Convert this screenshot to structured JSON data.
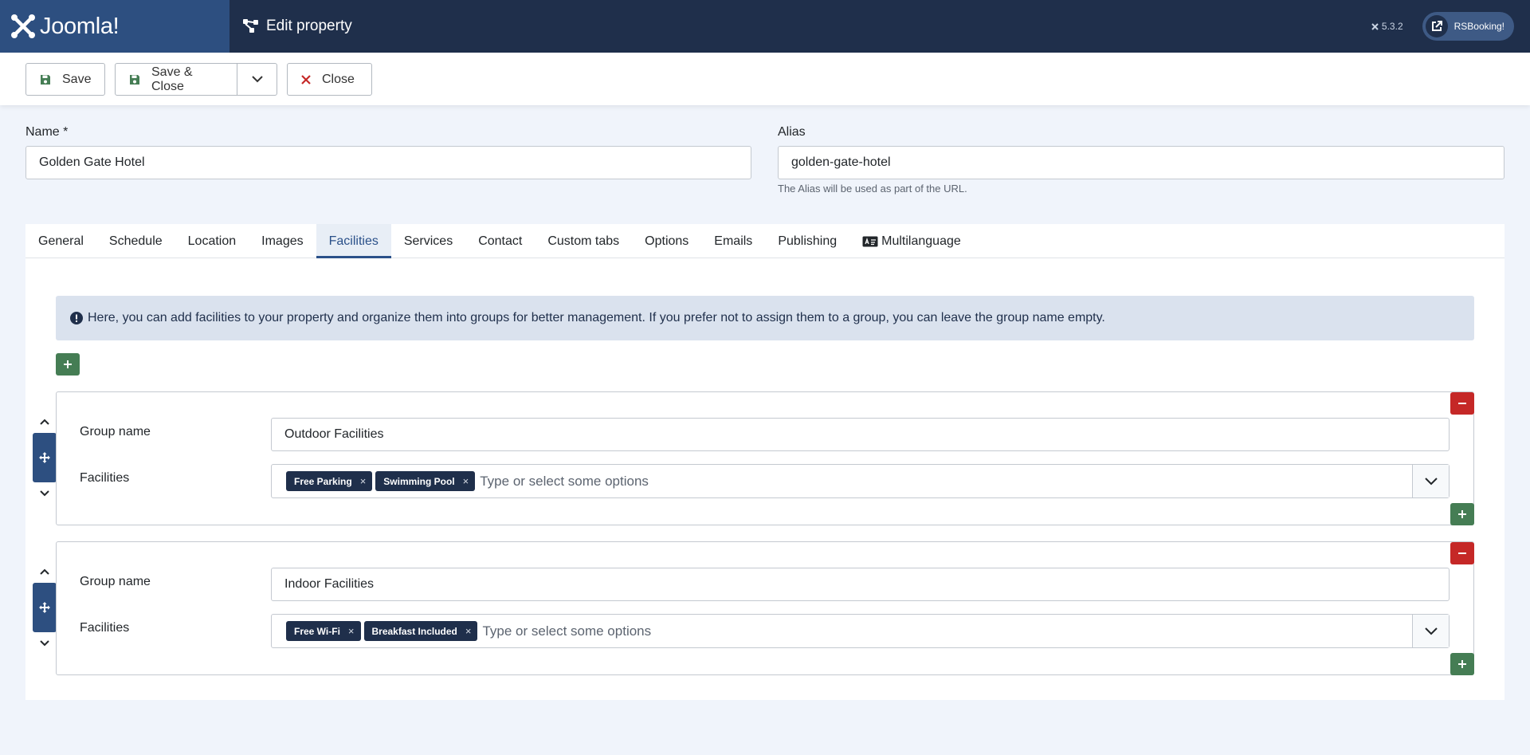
{
  "header": {
    "brand": "Joomla!",
    "page_title": "Edit property",
    "version": "5.3.2",
    "app_link": "RSBooking!"
  },
  "toolbar": {
    "save": "Save",
    "save_close": "Save & Close",
    "close": "Close"
  },
  "form": {
    "name_label": "Name *",
    "name_value": "Golden Gate Hotel",
    "alias_label": "Alias",
    "alias_value": "golden-gate-hotel",
    "alias_help": "The Alias will be used as part of the URL."
  },
  "tabs": [
    "General",
    "Schedule",
    "Location",
    "Images",
    "Facilities",
    "Services",
    "Contact",
    "Custom tabs",
    "Options",
    "Emails",
    "Publishing",
    "Multilanguage"
  ],
  "active_tab": "Facilities",
  "alert": "Here, you can add facilities to your property and organize them into groups for better management. If you prefer not to assign them to a group, you can leave the group name empty.",
  "groups": [
    {
      "group_name_label": "Group name",
      "group_name": "Outdoor Facilities",
      "facilities_label": "Facilities",
      "facilities": [
        "Free Parking",
        "Swimming Pool"
      ],
      "placeholder": "Type or select some options"
    },
    {
      "group_name_label": "Group name",
      "group_name": "Indoor Facilities",
      "facilities_label": "Facilities",
      "facilities": [
        "Free Wi-Fi",
        "Breakfast Included"
      ],
      "placeholder": "Type or select some options"
    }
  ],
  "colors": {
    "header_bg": "#1f2f4b",
    "brand_bg": "#2d4f80",
    "add_green": "#457d54",
    "remove_red": "#c52827",
    "chip_bg": "#1f2f4b",
    "alert_bg": "#dae2ee"
  },
  "icons": [
    "joomla-logo-icon",
    "hierarchy-icon",
    "joomla-small-icon",
    "external-link-icon",
    "save-icon",
    "chevron-down-icon",
    "close-x-icon",
    "info-icon",
    "plus-icon",
    "minus-icon",
    "move-icon",
    "chevron-up-icon",
    "language-card-icon"
  ]
}
